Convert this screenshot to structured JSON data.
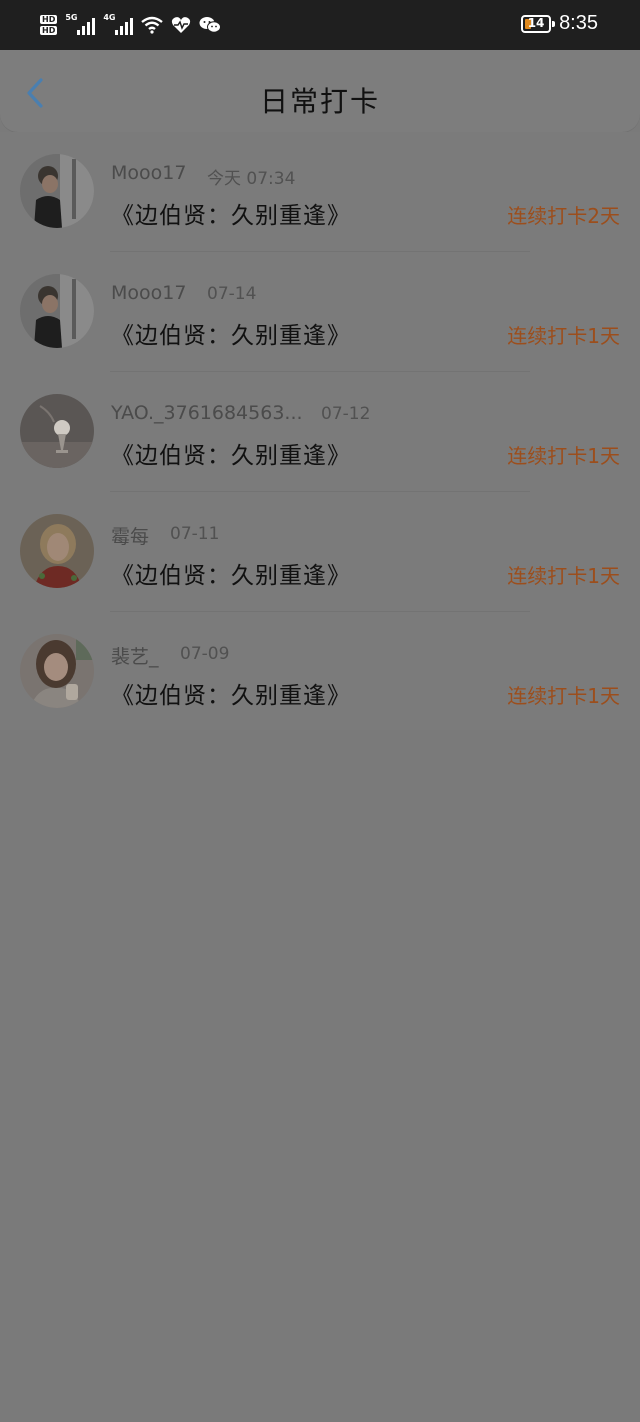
{
  "status_bar": {
    "hd1": "HD",
    "hd2": "HD",
    "net1": "5G",
    "net2": "4G",
    "battery": "14",
    "time": "8:35",
    "icons": [
      "wifi-icon",
      "heart-rate-icon",
      "wechat-icon"
    ]
  },
  "header": {
    "title": "日常打卡",
    "back_icon": "chevron-left-icon"
  },
  "colors": {
    "accent_back": "#4a7fb0",
    "streak_text": "#9c4e1c",
    "battery_fill": "#e08a1e"
  },
  "checkins": [
    {
      "name": "Mooo17",
      "date": "今天 07:34",
      "book": "《边伯贤：久别重逢》",
      "streak": "连续打卡2天"
    },
    {
      "name": "Mooo17",
      "date": "07-14",
      "book": "《边伯贤：久别重逢》",
      "streak": "连续打卡1天"
    },
    {
      "name": "YAO._3761684563...",
      "date": "07-12",
      "book": "《边伯贤：久别重逢》",
      "streak": "连续打卡1天"
    },
    {
      "name": "霉每",
      "date": "07-11",
      "book": "《边伯贤：久别重逢》",
      "streak": "连续打卡1天"
    },
    {
      "name": "裴艺_",
      "date": "07-09",
      "book": "《边伯贤：久别重逢》",
      "streak": "连续打卡1天"
    }
  ]
}
